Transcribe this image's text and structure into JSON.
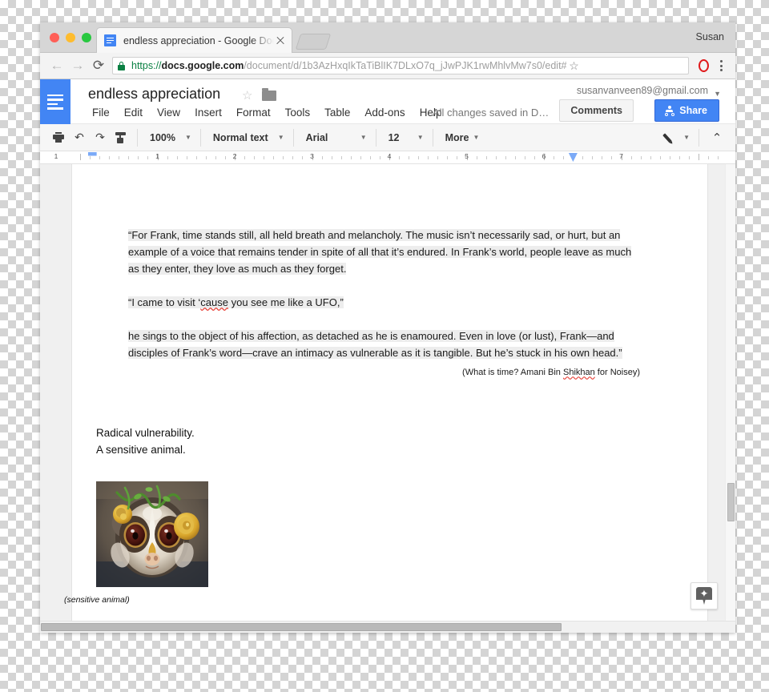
{
  "browser": {
    "profile_name": "Susan",
    "tab": {
      "title": "endless appreciation - Google Docs",
      "favicon": "google-docs-favicon"
    },
    "url": {
      "scheme": "https://",
      "host": "docs.google.com",
      "path": "/document/d/1b3AzHxqIkTaTiBlIK7DLxO7q_jJwPJK1rwMhlvMw7s0/edit#"
    },
    "icons": {
      "back": "←",
      "forward": "→",
      "reload": "⟳",
      "lock": "lock-icon",
      "bookmark": "☆",
      "extension": "opera-extension-icon",
      "menu": "kebab-menu-icon"
    }
  },
  "docs": {
    "logo": "google-docs-logo",
    "doc_title": "endless appreciation",
    "star": "☆",
    "folder": "move-to-folder-icon",
    "account_email": "susanvanveen89@gmail.com",
    "save_status": "All changes saved in D…",
    "comments_label": "Comments",
    "share_label": "Share",
    "menu": [
      {
        "label": "File"
      },
      {
        "label": "Edit"
      },
      {
        "label": "View"
      },
      {
        "label": "Insert"
      },
      {
        "label": "Format"
      },
      {
        "label": "Tools"
      },
      {
        "label": "Table"
      },
      {
        "label": "Add-ons"
      },
      {
        "label": "Help"
      }
    ],
    "toolbar": {
      "print": "print-icon",
      "undo": "↶",
      "redo": "↷",
      "paint_format": "paint-format-icon",
      "zoom_level": "100%",
      "paragraph_style": "Normal text",
      "font_family": "Arial",
      "font_size": "12",
      "more_label": "More",
      "edit_mode": "pencil-icon",
      "collapse": "⌃"
    },
    "ruler": {
      "numbers": [
        "1",
        "1",
        "2",
        "3",
        "4",
        "5",
        "6",
        "7"
      ],
      "left_indent_marker": "left-indent-marker",
      "right_margin_marker": "right-margin-marker"
    },
    "explore_button": "explore-icon"
  },
  "document": {
    "paragraphs": [
      {
        "id": "quote-1",
        "highlighted": true,
        "text": "“For Frank, time stands still, all held breath and melancholy. The music isn’t necessarily sad, or hurt, but an example of a voice that remains tender in spite of all that it’s endured. In Frank’s world, people leave as much as they enter, they love as much as they forget."
      },
      {
        "id": "quote-2",
        "highlighted": true,
        "pre": "“I came to visit ‘",
        "misspelled": "cause",
        "post": " you see me like a UFO,”"
      },
      {
        "id": "quote-3",
        "highlighted": true,
        "text": " he sings to the object of his affection, as detached as he is enamoured. Even in love (or lust), Frank—and disciples of Frank’s word—crave an intimacy as vulnerable as it is tangible. But he’s stuck in his own head.”"
      }
    ],
    "citation": {
      "pre": "(What is time? Amani Bin ",
      "misspelled": "Shikhan",
      "post": " for Noisey)"
    },
    "lead_lines": [
      "Radical vulnerability.",
      "A sensitive animal."
    ],
    "figure": {
      "alt": "slow-loris-photo",
      "caption": "(sensitive animal)"
    }
  },
  "colors": {
    "accent": "#4285f4",
    "secure_green": "#0b8043",
    "spellcheck_red": "#e8453c",
    "highlight": "#ededed",
    "toolbar_bg": "#f6f6f6"
  }
}
